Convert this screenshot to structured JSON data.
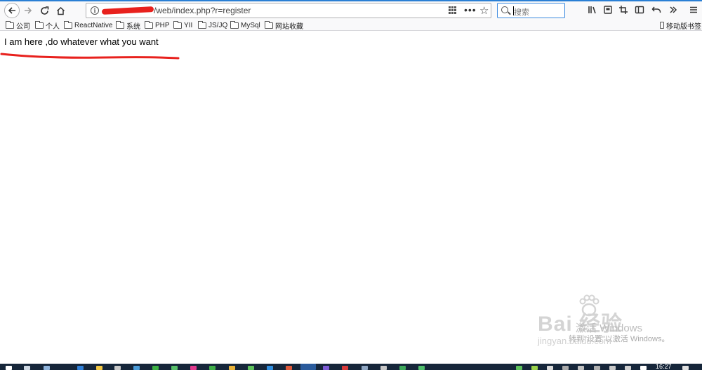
{
  "browser": {
    "url_text": "/web/index.php?r=register",
    "search_placeholder": "搜索",
    "bookmarks": [
      "公司",
      "个人",
      "ReactNative",
      "系统",
      "PHP",
      "YII",
      "JS/JQ",
      "MySql",
      "网站收藏"
    ],
    "mobile_bookmarks": "移动版书签"
  },
  "page": {
    "message": "I am here ,do whatever what you want"
  },
  "watermark": {
    "baidu": "Bai 经验",
    "jingyan": "jingyan.baidu.com",
    "activate_title": "激活 Windows",
    "activate_sub": "转到\"设置\"以激活 Windows。"
  },
  "taskbar": {
    "time": "16:27"
  },
  "colors": {
    "accent": "#2a7fd4",
    "redaction": "#e8211d",
    "taskbar": "#16263a"
  }
}
